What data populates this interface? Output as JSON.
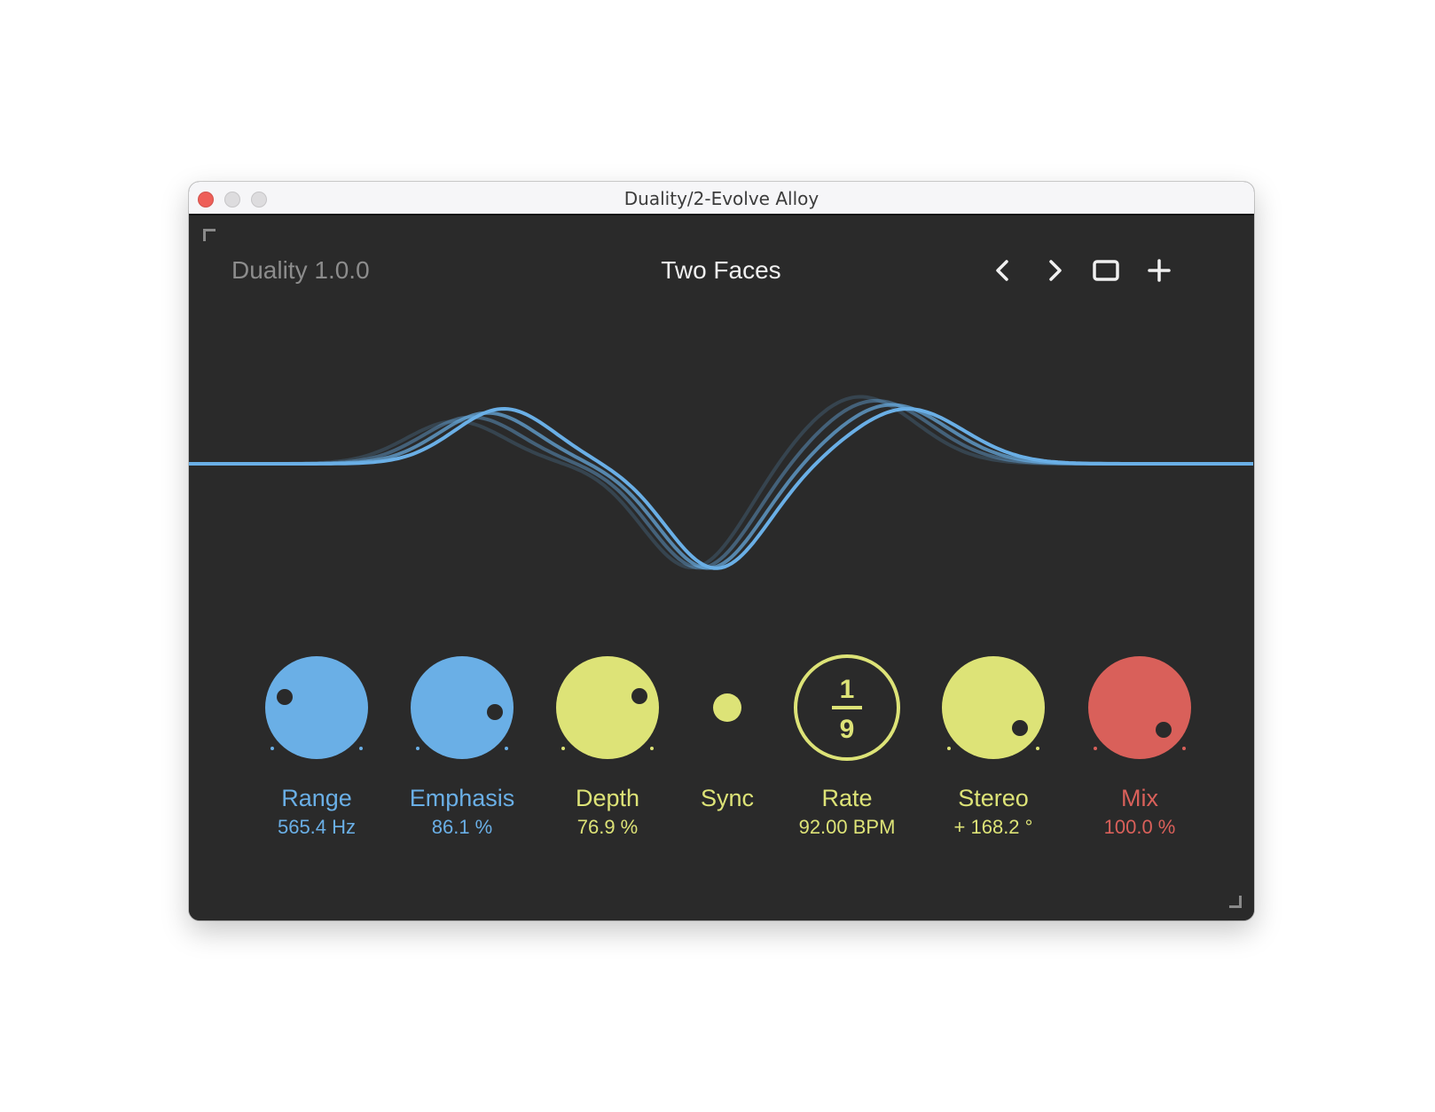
{
  "window": {
    "title": "Duality/2-Evolve Alloy"
  },
  "header": {
    "version": "Duality 1.0.0",
    "preset_name": "Two Faces",
    "buttons": {
      "prev": "chevron-left-icon",
      "next": "chevron-right-icon",
      "window": "window-icon",
      "add": "plus-icon"
    }
  },
  "colors": {
    "blue": "#6aafe6",
    "yellow": "#dde377",
    "red": "#d9605a",
    "background": "#2a2a2a"
  },
  "controls": {
    "range": {
      "label": "Range",
      "value": "565.4 Hz"
    },
    "emphasis": {
      "label": "Emphasis",
      "value": "86.1 %"
    },
    "depth": {
      "label": "Depth",
      "value": "76.9 %"
    },
    "sync": {
      "label": "Sync"
    },
    "rate": {
      "label": "Rate",
      "value": "92.00 BPM",
      "numerator": "1",
      "denominator": "9"
    },
    "stereo": {
      "label": "Stereo",
      "value": "+ 168.2 °"
    },
    "mix": {
      "label": "Mix",
      "value": "100.0 %"
    }
  }
}
